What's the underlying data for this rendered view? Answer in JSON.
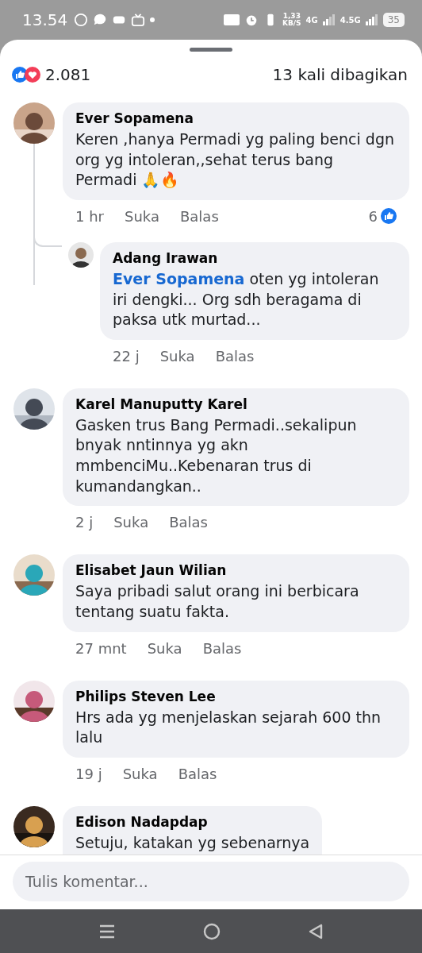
{
  "status_bar": {
    "time": "13.54",
    "speed": "1,33\nKB/S",
    "network_1": "4G",
    "network_2": "4.5G",
    "battery": "35"
  },
  "reactions": {
    "count": "2.081",
    "shares": "13 kali dibagikan"
  },
  "comments": [
    {
      "name": "Ever Sopamena",
      "text": "Keren ,hanya Permadi yg paling benci dgn org yg intoleran,,sehat terus bang Permadi 🙏🔥",
      "time": "1 hr",
      "like": "Suka",
      "reply": "Balas",
      "likes": "6",
      "replies": [
        {
          "name": "Adang Irawan",
          "mention": "Ever Sopamena",
          "text": "oten yg intoleran iri dengki... Org sdh beragama di paksa utk murtad...",
          "time": "22 j",
          "like": "Suka",
          "reply": "Balas"
        }
      ]
    },
    {
      "name": "Karel Manuputty Karel",
      "text": "Gasken trus Bang Permadi..sekalipun bnyak nntinnya yg akn mmbenciMu..Kebenaran trus di kumandangkan..",
      "time": "2 j",
      "like": "Suka",
      "reply": "Balas"
    },
    {
      "name": "Elisabet Jaun Wilian",
      "text": "Saya pribadi salut orang ini berbicara tentang suatu fakta.",
      "time": "27 mnt",
      "like": "Suka",
      "reply": "Balas"
    },
    {
      "name": "Philips Steven Lee",
      "text": "Hrs ada yg menjelaskan sejarah 600 thn lalu",
      "time": "19 j",
      "like": "Suka",
      "reply": "Balas"
    },
    {
      "name": "Edison Nadapdap",
      "text": "Setuju, katakan yg sebenarnya"
    }
  ],
  "composer": {
    "placeholder": "Tulis komentar..."
  }
}
